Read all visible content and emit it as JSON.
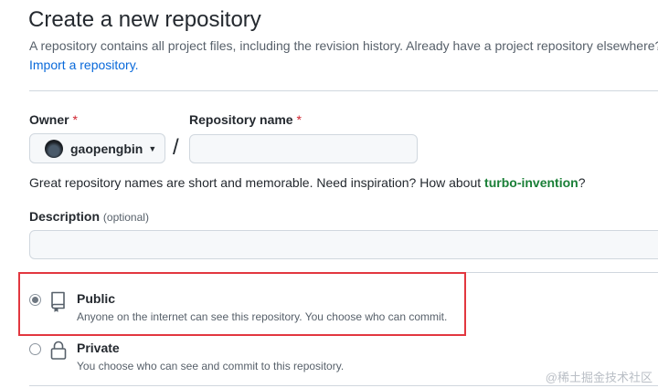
{
  "header": {
    "title": "Create a new repository",
    "subtitle": "A repository contains all project files, including the revision history. Already have a project repository elsewhere?",
    "import_link": "Import a repository."
  },
  "owner": {
    "label": "Owner",
    "required_mark": "*",
    "value": "gaopengbin",
    "avatar_icon": "user-avatar"
  },
  "separator": "/",
  "repo_name": {
    "label": "Repository name",
    "required_mark": "*",
    "value": "",
    "placeholder": ""
  },
  "name_hint": {
    "prefix": "Great repository names are short and memorable. Need inspiration? How about ",
    "suggestion": "turbo-invention",
    "suffix": "?"
  },
  "description": {
    "label": "Description",
    "optional": "(optional)",
    "value": "",
    "placeholder": ""
  },
  "visibility": {
    "selected": "public",
    "options": [
      {
        "id": "public",
        "title": "Public",
        "description": "Anyone on the internet can see this repository. You choose who can commit.",
        "icon": "repo-icon"
      },
      {
        "id": "private",
        "title": "Private",
        "description": "You choose who can see and commit to this repository.",
        "icon": "lock-icon"
      }
    ]
  },
  "colors": {
    "link": "#0969da",
    "required": "#cf222e",
    "suggestion": "#1a7f37",
    "highlight_border": "#e2373f"
  },
  "watermark": "@稀土掘金技术社区"
}
